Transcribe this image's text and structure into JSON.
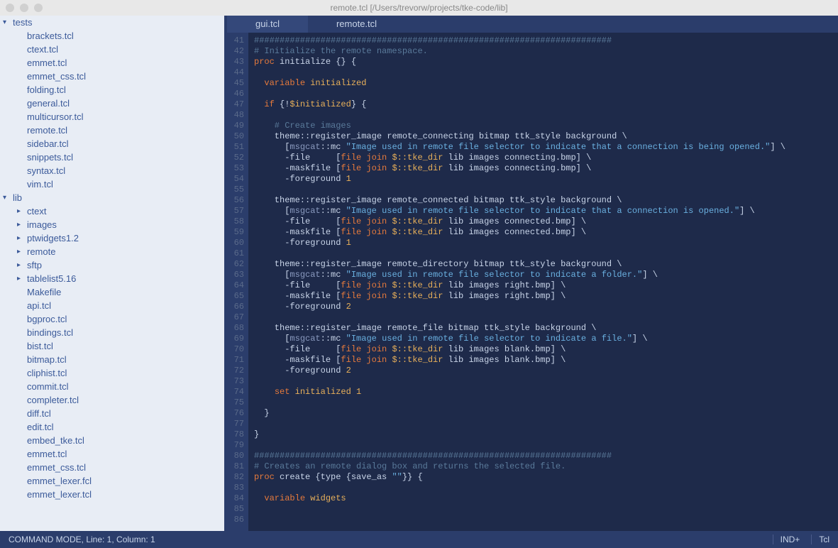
{
  "titlebar": {
    "title": "remote.tcl [/Users/trevorw/projects/tke-code/lib]"
  },
  "sidebar": {
    "tests_label": "tests",
    "tests_files": [
      "brackets.tcl",
      "ctext.tcl",
      "emmet.tcl",
      "emmet_css.tcl",
      "folding.tcl",
      "general.tcl",
      "multicursor.tcl",
      "remote.tcl",
      "sidebar.tcl",
      "snippets.tcl",
      "syntax.tcl",
      "vim.tcl"
    ],
    "lib_label": "lib",
    "lib_folders": [
      "ctext",
      "images",
      "ptwidgets1.2",
      "remote",
      "sftp",
      "tablelist5.16"
    ],
    "lib_files": [
      "Makefile",
      "api.tcl",
      "bgproc.tcl",
      "bindings.tcl",
      "bist.tcl",
      "bitmap.tcl",
      "cliphist.tcl",
      "commit.tcl",
      "completer.tcl",
      "diff.tcl",
      "edit.tcl",
      "embed_tke.tcl",
      "emmet.tcl",
      "emmet_css.tcl",
      "emmet_lexer.fcl",
      "emmet_lexer.tcl"
    ]
  },
  "tabs": {
    "inactive": "gui.tcl",
    "active": "remote.tcl"
  },
  "gutter": {
    "start": 41,
    "end": 86
  },
  "code_lines": [
    {
      "t": "cmt",
      "s": "######################################################################"
    },
    {
      "t": "cmt",
      "s": "# Initialize the remote namespace."
    },
    {
      "t": "mix",
      "parts": [
        [
          "kw",
          "proc"
        ],
        [
          "plain",
          " initialize {} {"
        ]
      ]
    },
    {
      "t": "blank",
      "s": ""
    },
    {
      "t": "mix",
      "parts": [
        [
          "plain",
          "  "
        ],
        [
          "kw",
          "variable"
        ],
        [
          "plain",
          " "
        ],
        [
          "var",
          "initialized"
        ]
      ]
    },
    {
      "t": "blank",
      "s": ""
    },
    {
      "t": "mix",
      "parts": [
        [
          "plain",
          "  "
        ],
        [
          "kw",
          "if"
        ],
        [
          "plain",
          " {!"
        ],
        [
          "var",
          "$initialized"
        ],
        [
          "plain",
          "} {"
        ]
      ]
    },
    {
      "t": "blank",
      "s": ""
    },
    {
      "t": "cmt",
      "s": "    # Create images"
    },
    {
      "t": "mix",
      "parts": [
        [
          "plain",
          "    theme::"
        ],
        [
          "plain",
          "register_image remote_connecting bitmap ttk_style background \\"
        ]
      ]
    },
    {
      "t": "mix",
      "parts": [
        [
          "plain",
          "      ["
        ],
        [
          "pale",
          "msgcat"
        ],
        [
          "plain",
          "::mc "
        ],
        [
          "str",
          "\"Image used in remote file selector to indicate that a connection is being opened.\""
        ],
        [
          "plain",
          "] \\"
        ]
      ]
    },
    {
      "t": "mix",
      "parts": [
        [
          "plain",
          "      -file     ["
        ],
        [
          "kw",
          "file join"
        ],
        [
          "plain",
          " "
        ],
        [
          "var",
          "$::tke_dir"
        ],
        [
          "plain",
          " lib images connecting.bmp] \\"
        ]
      ]
    },
    {
      "t": "mix",
      "parts": [
        [
          "plain",
          "      -maskfile ["
        ],
        [
          "kw",
          "file join"
        ],
        [
          "plain",
          " "
        ],
        [
          "var",
          "$::tke_dir"
        ],
        [
          "plain",
          " lib images connecting.bmp] \\"
        ]
      ]
    },
    {
      "t": "mix",
      "parts": [
        [
          "plain",
          "      -foreground "
        ],
        [
          "num",
          "1"
        ]
      ]
    },
    {
      "t": "blank",
      "s": ""
    },
    {
      "t": "mix",
      "parts": [
        [
          "plain",
          "    theme::register_image remote_connected bitmap ttk_style background \\"
        ]
      ]
    },
    {
      "t": "mix",
      "parts": [
        [
          "plain",
          "      ["
        ],
        [
          "pale",
          "msgcat"
        ],
        [
          "plain",
          "::mc "
        ],
        [
          "str",
          "\"Image used in remote file selector to indicate that a connection is opened.\""
        ],
        [
          "plain",
          "] \\"
        ]
      ]
    },
    {
      "t": "mix",
      "parts": [
        [
          "plain",
          "      -file     ["
        ],
        [
          "kw",
          "file join"
        ],
        [
          "plain",
          " "
        ],
        [
          "var",
          "$::tke_dir"
        ],
        [
          "plain",
          " lib images connected.bmp] \\"
        ]
      ]
    },
    {
      "t": "mix",
      "parts": [
        [
          "plain",
          "      -maskfile ["
        ],
        [
          "kw",
          "file join"
        ],
        [
          "plain",
          " "
        ],
        [
          "var",
          "$::tke_dir"
        ],
        [
          "plain",
          " lib images connected.bmp] \\"
        ]
      ]
    },
    {
      "t": "mix",
      "parts": [
        [
          "plain",
          "      -foreground "
        ],
        [
          "num",
          "1"
        ]
      ]
    },
    {
      "t": "blank",
      "s": ""
    },
    {
      "t": "mix",
      "parts": [
        [
          "plain",
          "    theme::register_image remote_directory bitmap ttk_style background \\"
        ]
      ]
    },
    {
      "t": "mix",
      "parts": [
        [
          "plain",
          "      ["
        ],
        [
          "pale",
          "msgcat"
        ],
        [
          "plain",
          "::mc "
        ],
        [
          "str",
          "\"Image used in remote file selector to indicate a folder.\""
        ],
        [
          "plain",
          "] \\"
        ]
      ]
    },
    {
      "t": "mix",
      "parts": [
        [
          "plain",
          "      -file     ["
        ],
        [
          "kw",
          "file join"
        ],
        [
          "plain",
          " "
        ],
        [
          "var",
          "$::tke_dir"
        ],
        [
          "plain",
          " lib images right.bmp] \\"
        ]
      ]
    },
    {
      "t": "mix",
      "parts": [
        [
          "plain",
          "      -maskfile ["
        ],
        [
          "kw",
          "file join"
        ],
        [
          "plain",
          " "
        ],
        [
          "var",
          "$::tke_dir"
        ],
        [
          "plain",
          " lib images right.bmp] \\"
        ]
      ]
    },
    {
      "t": "mix",
      "parts": [
        [
          "plain",
          "      -foreground "
        ],
        [
          "num",
          "2"
        ]
      ]
    },
    {
      "t": "blank",
      "s": ""
    },
    {
      "t": "mix",
      "parts": [
        [
          "plain",
          "    theme::register_image remote_file bitmap ttk_style background \\"
        ]
      ]
    },
    {
      "t": "mix",
      "parts": [
        [
          "plain",
          "      ["
        ],
        [
          "pale",
          "msgcat"
        ],
        [
          "plain",
          "::mc "
        ],
        [
          "str",
          "\"Image used in remote file selector to indicate a file.\""
        ],
        [
          "plain",
          "] \\"
        ]
      ]
    },
    {
      "t": "mix",
      "parts": [
        [
          "plain",
          "      -file     ["
        ],
        [
          "kw",
          "file join"
        ],
        [
          "plain",
          " "
        ],
        [
          "var",
          "$::tke_dir"
        ],
        [
          "plain",
          " lib images blank.bmp] \\"
        ]
      ]
    },
    {
      "t": "mix",
      "parts": [
        [
          "plain",
          "      -maskfile ["
        ],
        [
          "kw",
          "file join"
        ],
        [
          "plain",
          " "
        ],
        [
          "var",
          "$::tke_dir"
        ],
        [
          "plain",
          " lib images blank.bmp] \\"
        ]
      ]
    },
    {
      "t": "mix",
      "parts": [
        [
          "plain",
          "      -foreground "
        ],
        [
          "num",
          "2"
        ]
      ]
    },
    {
      "t": "blank",
      "s": ""
    },
    {
      "t": "mix",
      "parts": [
        [
          "plain",
          "    "
        ],
        [
          "kw",
          "set"
        ],
        [
          "plain",
          " "
        ],
        [
          "var",
          "initialized"
        ],
        [
          "plain",
          " "
        ],
        [
          "num",
          "1"
        ]
      ]
    },
    {
      "t": "blank",
      "s": ""
    },
    {
      "t": "plain",
      "s": "  }"
    },
    {
      "t": "blank",
      "s": ""
    },
    {
      "t": "plain",
      "s": "}"
    },
    {
      "t": "blank",
      "s": ""
    },
    {
      "t": "cmt",
      "s": "######################################################################"
    },
    {
      "t": "cmt",
      "s": "# Creates an remote dialog box and returns the selected file."
    },
    {
      "t": "mix",
      "parts": [
        [
          "kw",
          "proc"
        ],
        [
          "plain",
          " create {type {save_as "
        ],
        [
          "str",
          "\"\""
        ],
        [
          "plain",
          "}} {"
        ]
      ]
    },
    {
      "t": "blank",
      "s": ""
    },
    {
      "t": "mix",
      "parts": [
        [
          "plain",
          "  "
        ],
        [
          "kw",
          "variable"
        ],
        [
          "plain",
          " "
        ],
        [
          "var",
          "widgets"
        ]
      ]
    },
    {
      "t": "blank",
      "s": ""
    },
    {
      "t": "blank",
      "s": ""
    }
  ],
  "status": {
    "left": "COMMAND MODE, Line: 1, Column: 1",
    "indent": "IND+",
    "lang": "Tcl"
  }
}
